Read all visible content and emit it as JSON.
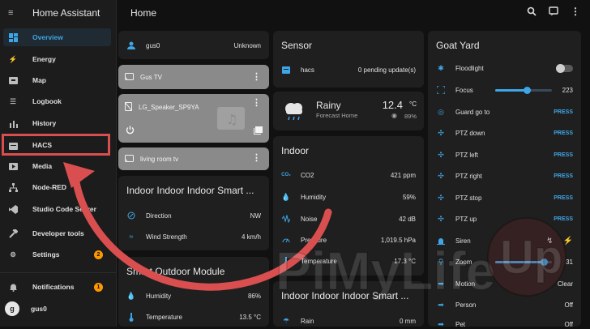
{
  "sidebar": {
    "title": "Home Assistant",
    "items": [
      {
        "label": "Overview",
        "icon": "grid-icon"
      },
      {
        "label": "Energy",
        "icon": "bolt-icon"
      },
      {
        "label": "Map",
        "icon": "map-icon"
      },
      {
        "label": "Logbook",
        "icon": "list-icon"
      },
      {
        "label": "History",
        "icon": "chart-icon"
      },
      {
        "label": "HACS",
        "icon": "hacs-icon"
      },
      {
        "label": "Media",
        "icon": "media-icon"
      },
      {
        "label": "Node-RED",
        "icon": "sitemap-icon"
      },
      {
        "label": "Studio Code Server",
        "icon": "vscode-icon"
      },
      {
        "label": "Developer tools",
        "icon": "hammer-icon"
      },
      {
        "label": "Settings",
        "icon": "gear-icon",
        "badge": "2"
      }
    ],
    "notifications": {
      "label": "Notifications",
      "badge": "1"
    },
    "user": {
      "label": "gus0",
      "initial": "g"
    }
  },
  "header": {
    "title": "Home"
  },
  "col1": {
    "person": {
      "name": "gus0",
      "state": "Unknown"
    },
    "media": [
      {
        "name": "Gus TV"
      },
      {
        "name": "LG_Speaker_SP9YA"
      },
      {
        "name": "living room tv"
      }
    ],
    "weather_station": {
      "title": "Indoor Indoor Indoor Smart ...",
      "rows": [
        {
          "label": "Direction",
          "value": "NW"
        },
        {
          "label": "Wind Strength",
          "value": "4 km/h"
        }
      ]
    },
    "outdoor": {
      "title": "Smart Outdoor Module",
      "rows": [
        {
          "label": "Humidity",
          "value": "86%"
        },
        {
          "label": "Temperature",
          "value": "13.5 °C"
        }
      ]
    }
  },
  "col2": {
    "sensor": {
      "title": "Sensor",
      "row": {
        "label": "hacs",
        "value": "0 pending update(s)"
      }
    },
    "weather": {
      "condition": "Rainy",
      "location": "Forecast Home",
      "temp": "12.4",
      "unit": "°C",
      "humidity": "89%"
    },
    "indoor": {
      "title": "Indoor",
      "rows": [
        {
          "label": "CO2",
          "value": "421 ppm"
        },
        {
          "label": "Humidity",
          "value": "59%"
        },
        {
          "label": "Noise",
          "value": "42 dB"
        },
        {
          "label": "Pressure",
          "value": "1,019.5 hPa"
        },
        {
          "label": "Temperature",
          "value": "17.3 °C"
        }
      ]
    },
    "indoor2": {
      "title": "Indoor Indoor Indoor Smart ...",
      "rows": [
        {
          "label": "Rain",
          "value": "0 mm"
        }
      ]
    }
  },
  "col3": {
    "title": "Goat Yard",
    "rows": [
      {
        "label": "Floodlight",
        "type": "toggle",
        "value": ""
      },
      {
        "label": "Focus",
        "type": "slider",
        "value": "223",
        "level": 0.55
      },
      {
        "label": "Guard go to",
        "type": "press",
        "value": "PRESS"
      },
      {
        "label": "PTZ down",
        "type": "press",
        "value": "PRESS"
      },
      {
        "label": "PTZ left",
        "type": "press",
        "value": "PRESS"
      },
      {
        "label": "PTZ right",
        "type": "press",
        "value": "PRESS"
      },
      {
        "label": "PTZ stop",
        "type": "press",
        "value": "PRESS"
      },
      {
        "label": "PTZ up",
        "type": "press",
        "value": "PRESS"
      },
      {
        "label": "Siren",
        "type": "icon",
        "value": ""
      },
      {
        "label": "Zoom",
        "type": "slider",
        "value": "31",
        "level": 0.85
      },
      {
        "label": "Motion",
        "type": "text",
        "value": "Clear"
      },
      {
        "label": "Person",
        "type": "text",
        "value": "Off"
      },
      {
        "label": "Pet",
        "type": "text",
        "value": "Off"
      }
    ]
  },
  "watermark": {
    "text": "PiMyLifeUp"
  },
  "colors": {
    "accent": "#3ea6e6",
    "highlight": "#d94f4f",
    "badge": "#ff9800"
  }
}
